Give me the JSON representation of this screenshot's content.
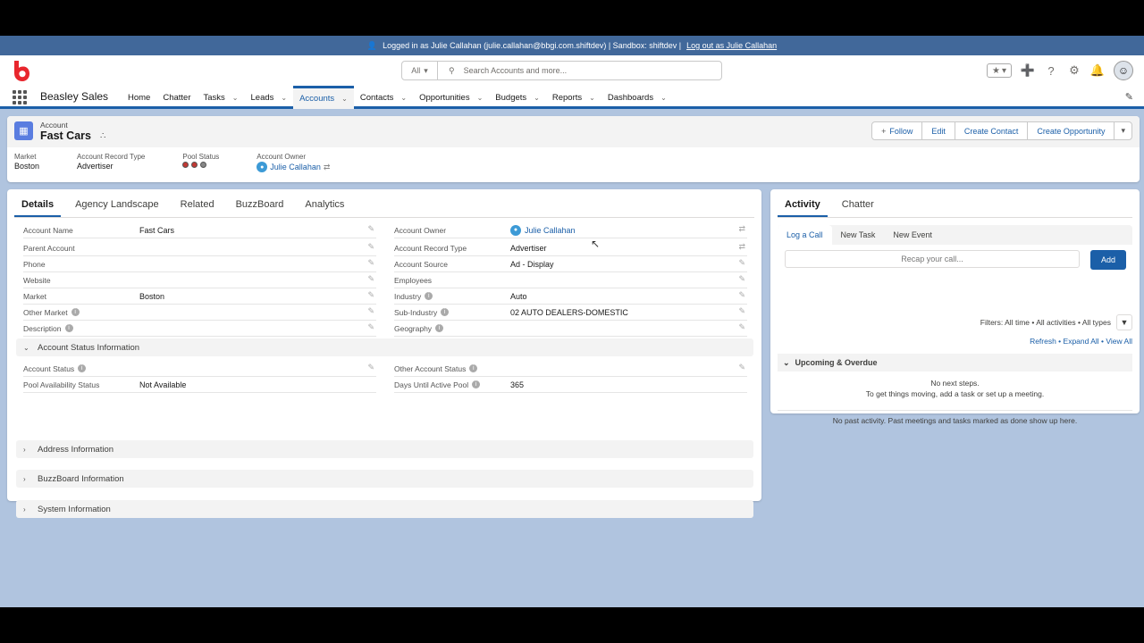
{
  "banner": {
    "logged_in_text": "Logged in as Julie Callahan (julie.callahan@bbgi.com.shiftdev) | Sandbox: shiftdev |",
    "logout_text": "Log out as Julie Callahan"
  },
  "header": {
    "search_scope": "All",
    "search_placeholder": "Search Accounts and more..."
  },
  "nav": {
    "app_name": "Beasley Sales",
    "items": [
      {
        "label": "Home",
        "has_menu": false
      },
      {
        "label": "Chatter",
        "has_menu": false
      },
      {
        "label": "Tasks",
        "has_menu": true
      },
      {
        "label": "Leads",
        "has_menu": true
      },
      {
        "label": "Accounts",
        "has_menu": true,
        "active": true
      },
      {
        "label": "Contacts",
        "has_menu": true
      },
      {
        "label": "Opportunities",
        "has_menu": true
      },
      {
        "label": "Budgets",
        "has_menu": true
      },
      {
        "label": "Reports",
        "has_menu": true
      },
      {
        "label": "Dashboards",
        "has_menu": true
      }
    ]
  },
  "record": {
    "object_label": "Account",
    "name": "Fast Cars",
    "actions": {
      "follow": "Follow",
      "edit": "Edit",
      "create_contact": "Create Contact",
      "create_opportunity": "Create Opportunity"
    },
    "highlights": {
      "market_label": "Market",
      "market_value": "Boston",
      "record_type_label": "Account Record Type",
      "record_type_value": "Advertiser",
      "pool_status_label": "Pool Status",
      "owner_label": "Account Owner",
      "owner_value": "Julie Callahan"
    }
  },
  "details": {
    "tabs": [
      "Details",
      "Agency Landscape",
      "Related",
      "BuzzBoard",
      "Analytics"
    ],
    "left_fields": [
      {
        "label": "Account Name",
        "value": "Fast Cars"
      },
      {
        "label": "Parent Account",
        "value": ""
      },
      {
        "label": "Phone",
        "value": ""
      },
      {
        "label": "Website",
        "value": ""
      },
      {
        "label": "Market",
        "value": "Boston"
      },
      {
        "label": "Other Market",
        "value": ""
      },
      {
        "label": "Description",
        "value": ""
      }
    ],
    "right_fields": [
      {
        "label": "Account Owner",
        "value": "Julie Callahan"
      },
      {
        "label": "Account Record Type",
        "value": "Advertiser"
      },
      {
        "label": "Account Source",
        "value": "Ad - Display"
      },
      {
        "label": "Employees",
        "value": ""
      },
      {
        "label": "Industry",
        "value": "Auto"
      },
      {
        "label": "Sub-Industry",
        "value": "02 AUTO DEALERS-DOMESTIC"
      },
      {
        "label": "Geography",
        "value": ""
      }
    ],
    "status_section": "Account Status Information",
    "status_fields": {
      "account_status_label": "Account Status",
      "account_status_value": "",
      "pool_availability_label": "Pool Availability Status",
      "pool_availability_value": "Not Available",
      "other_status_label": "Other Account Status",
      "other_status_value": "",
      "days_until_label": "Days Until Active Pool",
      "days_until_value": "365"
    },
    "sections": [
      "Address Information",
      "BuzzBoard Information",
      "System Information"
    ]
  },
  "activity": {
    "tabs": [
      "Activity",
      "Chatter"
    ],
    "publisher_tabs": [
      "Log a Call",
      "New Task",
      "New Event"
    ],
    "recap_placeholder": "Recap your call...",
    "add_label": "Add",
    "filters_text": "Filters: All time • All activities • All types",
    "links_text": "Refresh • Expand All • View All",
    "upcoming_label": "Upcoming & Overdue",
    "no_steps": "No next steps.",
    "no_steps_hint": "To get things moving, add a task or set up a meeting.",
    "past_text": "No past activity. Past meetings and tasks marked as done show up here."
  }
}
